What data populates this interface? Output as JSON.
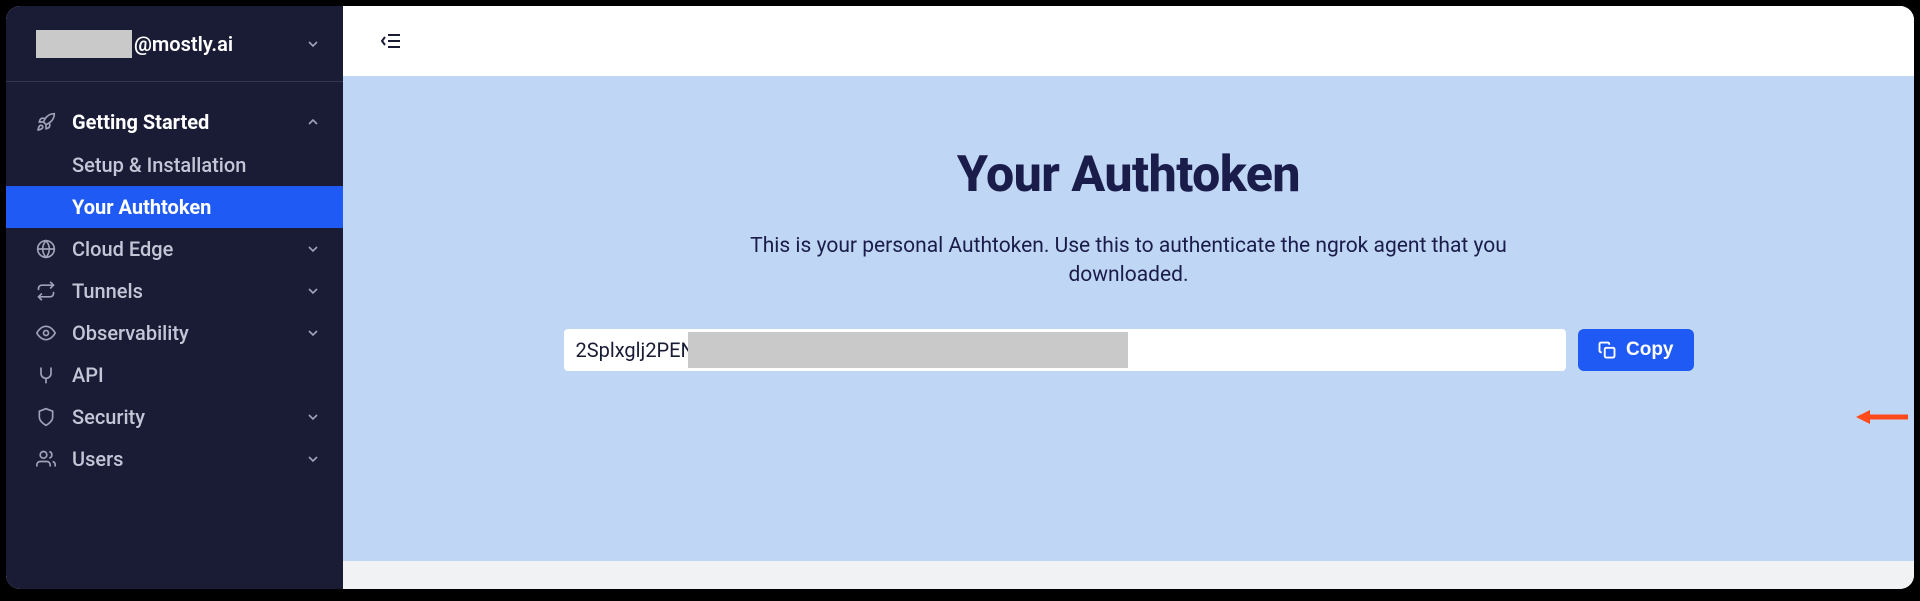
{
  "user": {
    "email_domain": "@mostly.ai"
  },
  "sidebar": {
    "sections": [
      {
        "id": "getting-started",
        "label": "Getting Started",
        "icon": "rocket",
        "expanded": true,
        "items": [
          {
            "id": "setup",
            "label": "Setup & Installation",
            "active": false
          },
          {
            "id": "authtoken",
            "label": "Your Authtoken",
            "active": true
          }
        ]
      },
      {
        "id": "cloud-edge",
        "label": "Cloud Edge",
        "icon": "globe"
      },
      {
        "id": "tunnels",
        "label": "Tunnels",
        "icon": "transfer"
      },
      {
        "id": "observability",
        "label": "Observability",
        "icon": "eye"
      },
      {
        "id": "api",
        "label": "API",
        "icon": "connector"
      },
      {
        "id": "security",
        "label": "Security",
        "icon": "shield"
      },
      {
        "id": "users",
        "label": "Users",
        "icon": "users"
      }
    ]
  },
  "page": {
    "title": "Your Authtoken",
    "description": "This is your personal Authtoken. Use this to authenticate the ngrok agent that you downloaded.",
    "token_prefix": "2Splxglj2PEN",
    "copy_label": "Copy"
  }
}
